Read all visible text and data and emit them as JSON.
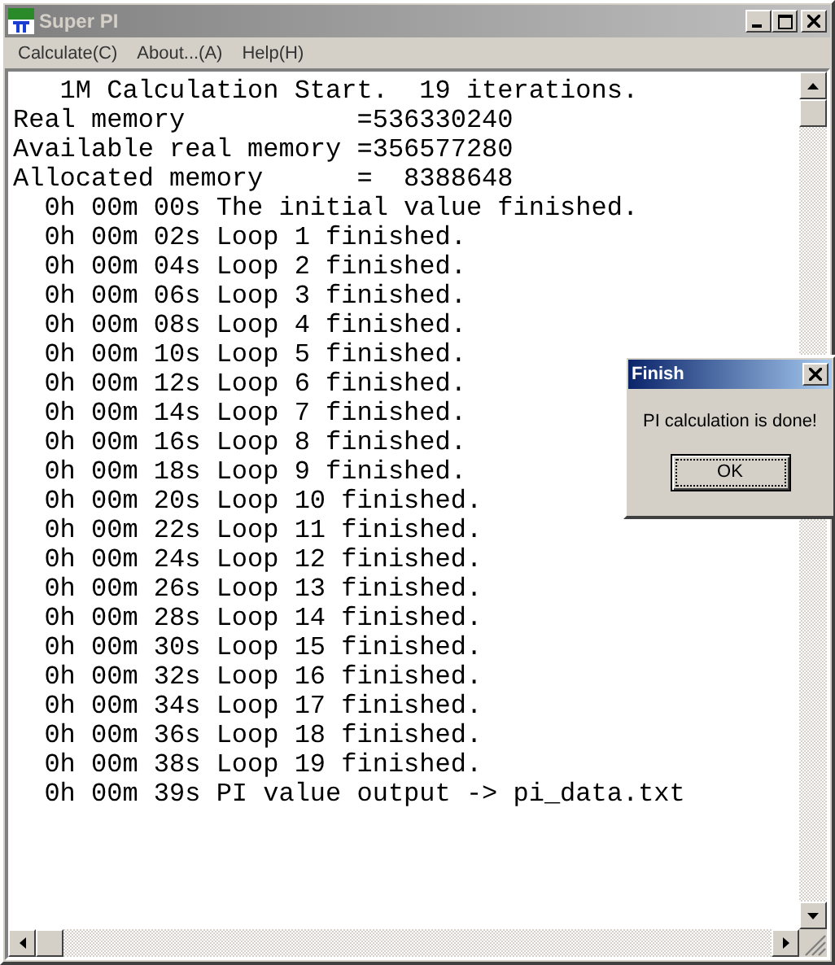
{
  "window": {
    "title": "Super PI"
  },
  "menu": [
    "Calculate(C)",
    "About...(A)",
    "Help(H)"
  ],
  "output_lines": [
    "   1M Calculation Start.  19 iterations.",
    "Real memory           =536330240",
    "Available real memory =356577280",
    "Allocated memory      =  8388648",
    "  0h 00m 00s The initial value finished.",
    "  0h 00m 02s Loop 1 finished.",
    "  0h 00m 04s Loop 2 finished.",
    "  0h 00m 06s Loop 3 finished.",
    "  0h 00m 08s Loop 4 finished.",
    "  0h 00m 10s Loop 5 finished.",
    "  0h 00m 12s Loop 6 finished.",
    "  0h 00m 14s Loop 7 finished.",
    "  0h 00m 16s Loop 8 finished.",
    "  0h 00m 18s Loop 9 finished.",
    "  0h 00m 20s Loop 10 finished.",
    "  0h 00m 22s Loop 11 finished.",
    "  0h 00m 24s Loop 12 finished.",
    "  0h 00m 26s Loop 13 finished.",
    "  0h 00m 28s Loop 14 finished.",
    "  0h 00m 30s Loop 15 finished.",
    "  0h 00m 32s Loop 16 finished.",
    "  0h 00m 34s Loop 17 finished.",
    "  0h 00m 36s Loop 18 finished.",
    "  0h 00m 38s Loop 19 finished.",
    "  0h 00m 39s PI value output -> pi_data.txt"
  ],
  "dialog": {
    "title": "Finish",
    "message": "PI calculation is done!",
    "button": "OK"
  }
}
